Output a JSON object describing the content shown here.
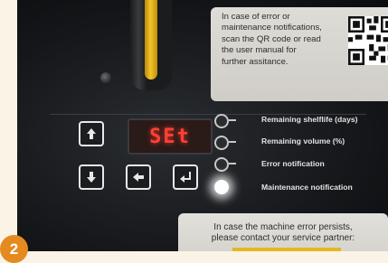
{
  "notice": {
    "text": "In case of error or\nmaintenance notifications,\nscan the QR code or read\nthe user manual for\nfurther assitance."
  },
  "display": {
    "text": "SEt"
  },
  "indicators": [
    {
      "label": "Remaining shelflife (days)",
      "state": "off"
    },
    {
      "label": "Remaining volume (%)",
      "state": "off"
    },
    {
      "label": "Error notification",
      "state": "off"
    },
    {
      "label": "Maintenance notification",
      "state": "on"
    }
  ],
  "bottom_label": {
    "text": "In case the machine error persists,\nplease contact your service partner:"
  },
  "step_badge": "2",
  "colors": {
    "display_text": "#ff4032",
    "badge": "#e58a1f",
    "led_on": "#ffffff"
  },
  "icons": [
    "up-arrow-icon",
    "down-arrow-icon",
    "left-arrow-icon",
    "enter-icon",
    "qr-code-icon"
  ]
}
